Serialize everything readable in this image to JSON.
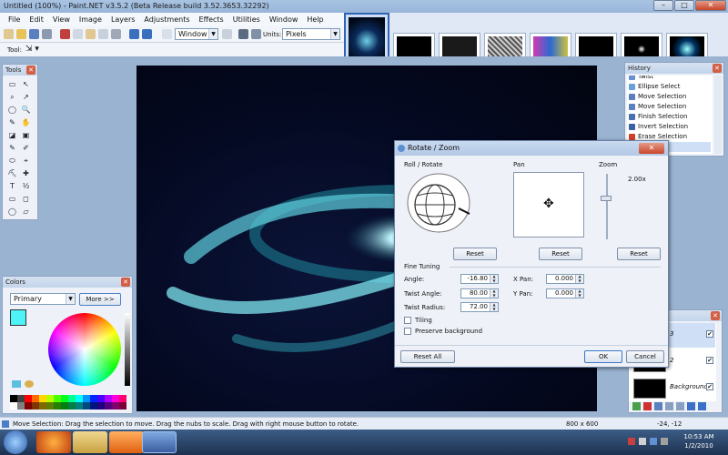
{
  "app": {
    "title": "Untitled (100%) - Paint.NET v3.5.2 (Beta Release build 3.52.3653.32292)",
    "window_controls": {
      "minimize": "–",
      "maximize": "□",
      "close": "✕"
    }
  },
  "menu": [
    "File",
    "Edit",
    "View",
    "Image",
    "Layers",
    "Adjustments",
    "Effects",
    "Utilities",
    "Window",
    "Help"
  ],
  "toolbar": {
    "zoom_value": "Window",
    "units_label": "Units:",
    "units_value": "Pixels",
    "tool_label": "Tool:"
  },
  "tools_panel": {
    "title": "Tools",
    "tools": [
      "▭",
      "↖",
      "⌕",
      "↗",
      "◯",
      "🔍",
      "✎",
      "✋",
      "◪",
      "▣",
      "✎",
      "✐",
      "⬭",
      "⌖",
      "⛏",
      "✚",
      "T",
      "½",
      "▭",
      "◻",
      "◯",
      "▱"
    ]
  },
  "colors_panel": {
    "title": "Colors",
    "mode_value": "Primary",
    "more_label": "More >>",
    "primary_color": "#4df3f6",
    "palette": [
      "#000000",
      "#404040",
      "#ff0000",
      "#ff6a00",
      "#ffd800",
      "#b6ff00",
      "#4cff00",
      "#00ff21",
      "#00ff90",
      "#00ffff",
      "#0094ff",
      "#0026ff",
      "#4800ff",
      "#b200ff",
      "#ff00dc",
      "#ff006e",
      "#ffffff",
      "#808080",
      "#7f0000",
      "#7f3300",
      "#7f6a00",
      "#5b7f00",
      "#267f00",
      "#007f0e",
      "#007f46",
      "#007f7f",
      "#004a7f",
      "#00137f",
      "#21007f",
      "#57007f",
      "#7f006e",
      "#7f0037"
    ]
  },
  "history_panel": {
    "title": "History",
    "items": [
      {
        "label": "Twist",
        "icon": "#6a8fd0"
      },
      {
        "label": "Ellipse Select",
        "icon": "#6aa0d8"
      },
      {
        "label": "Move Selection",
        "icon": "#5a7fc0"
      },
      {
        "label": "Move Selection",
        "icon": "#5a7fc0"
      },
      {
        "label": "Finish Selection",
        "icon": "#4a6fb0"
      },
      {
        "label": "Invert Selection",
        "icon": "#3a60a8"
      },
      {
        "label": "Erase Selection",
        "icon": "#d0402a"
      },
      {
        "label": "",
        "icon": "#a8c4ea"
      }
    ]
  },
  "layers_panel": {
    "rows": [
      {
        "name": "3",
        "checked": "✔"
      },
      {
        "name": "2",
        "checked": "✔"
      },
      {
        "name": "Background",
        "checked": "✔"
      }
    ]
  },
  "dialog": {
    "title": "Rotate / Zoom",
    "roll_label": "Roll / Rotate",
    "pan_label": "Pan",
    "zoom_label": "Zoom",
    "zoom_value": "2.00x",
    "reset_label": "Reset",
    "fine_tuning_label": "Fine Tuning",
    "angle_label": "Angle:",
    "angle_value": "-16.80",
    "twist_angle_label": "Twist Angle:",
    "twist_angle_value": "80.00",
    "twist_radius_label": "Twist Radius:",
    "twist_radius_value": "72.00",
    "xpan_label": "X Pan:",
    "xpan_value": "0.000",
    "ypan_label": "Y Pan:",
    "ypan_value": "0.000",
    "tiling_label": "Tiling",
    "preserve_label": "Preserve background",
    "reset_all_label": "Reset All",
    "ok_label": "OK",
    "cancel_label": "Cancel"
  },
  "status": {
    "message": "Move Selection: Drag the selection to move. Drag the nubs to scale. Drag with right mouse button to rotate.",
    "image_size": "800 x 600",
    "cursor_pos": "-24, -12"
  },
  "taskbar": {
    "time": "10:53 AM",
    "date": "1/2/2010"
  }
}
